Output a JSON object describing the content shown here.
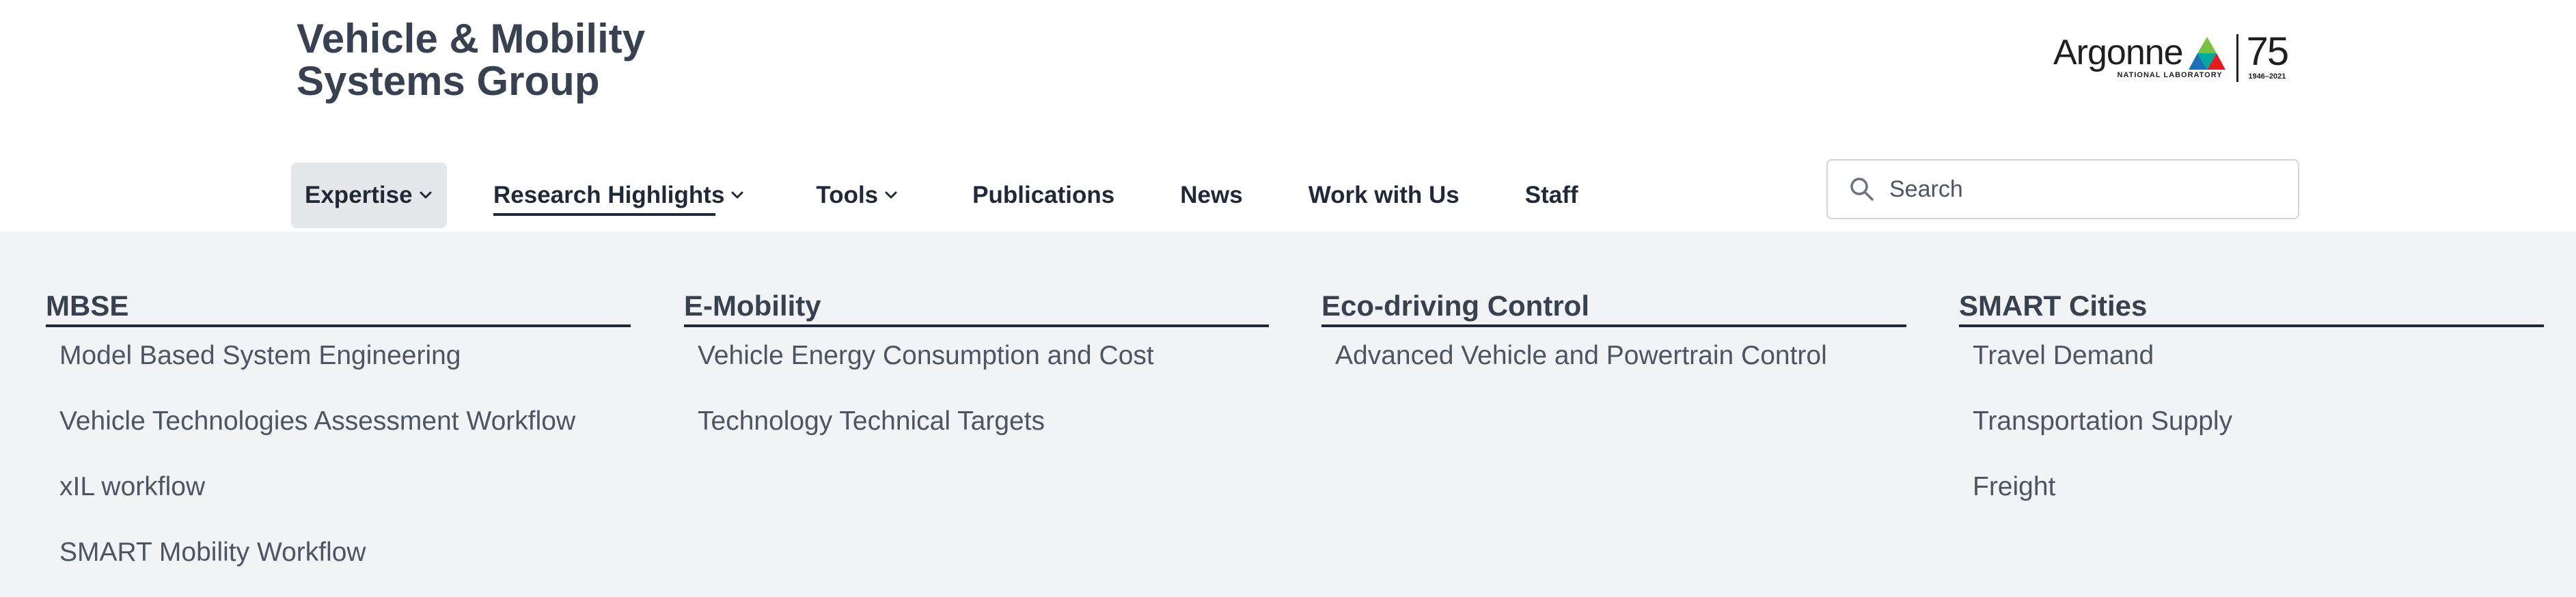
{
  "header": {
    "title_line1": "Vehicle & Mobility",
    "title_line2": "Systems Group",
    "logo": {
      "name": "Argonne",
      "sub": "NATIONAL LABORATORY",
      "anniversary": "75",
      "years": "1946–2021",
      "colors": [
        "#e31b23",
        "#7ac143",
        "#1d6fb8",
        "#00a99d",
        "#f7941d"
      ]
    }
  },
  "nav": {
    "items": [
      {
        "label": "Expertise",
        "has_dropdown": true,
        "active": true
      },
      {
        "label": "Research Highlights",
        "has_dropdown": true
      },
      {
        "label": "Tools",
        "has_dropdown": true
      },
      {
        "label": "Publications"
      },
      {
        "label": "News"
      },
      {
        "label": "Work with Us"
      },
      {
        "label": "Staff"
      }
    ]
  },
  "search": {
    "placeholder": "Search",
    "icon": "search-icon"
  },
  "mega_menu": {
    "columns": [
      {
        "heading": "MBSE",
        "links": [
          "Model Based System Engineering",
          "Vehicle Technologies Assessment Workflow",
          "xIL workflow",
          "SMART Mobility Workflow"
        ]
      },
      {
        "heading": "E-Mobility",
        "links": [
          "Vehicle Energy Consumption and Cost",
          "Technology Technical Targets"
        ]
      },
      {
        "heading": "Eco-driving Control",
        "links": [
          "Advanced Vehicle and Powertrain Control"
        ]
      },
      {
        "heading": "SMART Cities",
        "links": [
          "Travel Demand",
          "Transportation Supply",
          "Freight"
        ]
      }
    ]
  },
  "colors": {
    "text_dark": "#1f2937",
    "text": "#374151",
    "text_muted": "#4b5563",
    "menu_bg": "#f2f3f5",
    "active_nav_bg": "#e5e7eb"
  }
}
